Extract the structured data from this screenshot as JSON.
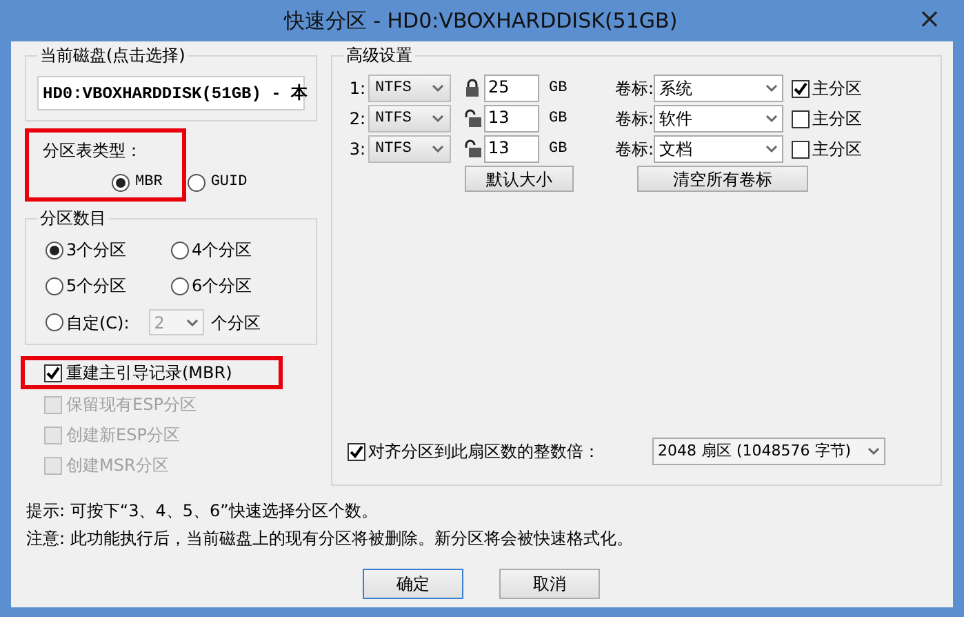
{
  "window": {
    "title": "快速分区 - HD0:VBOXHARDDISK(51GB)",
    "close": "×"
  },
  "current_disk": {
    "legend": "当前磁盘(点击选择)",
    "value": "HD0:VBOXHARDDISK(51GB) - 本"
  },
  "partition_table": {
    "label": "分区表类型：",
    "highlighted": true,
    "options": [
      {
        "label": "MBR",
        "selected": true
      },
      {
        "label": "GUID",
        "selected": false
      }
    ]
  },
  "partition_count": {
    "legend": "分区数目",
    "options": [
      {
        "label": "3个分区",
        "selected": true
      },
      {
        "label": "4个分区",
        "selected": false
      },
      {
        "label": "5个分区",
        "selected": false
      },
      {
        "label": "6个分区",
        "selected": false
      },
      {
        "label": "自定(C):",
        "selected": false
      }
    ],
    "custom_value": "2",
    "custom_suffix": "个分区"
  },
  "options": [
    {
      "label": "重建主引导记录(MBR)",
      "checked": true,
      "disabled": false,
      "highlighted": true
    },
    {
      "label": "保留现有ESP分区",
      "checked": false,
      "disabled": true,
      "highlighted": false
    },
    {
      "label": "创建新ESP分区",
      "checked": false,
      "disabled": true,
      "highlighted": false
    },
    {
      "label": "创建MSR分区",
      "checked": false,
      "disabled": true,
      "highlighted": false
    }
  ],
  "advanced": {
    "legend": "高级设置",
    "rows": [
      {
        "index": "1:",
        "fs": "NTFS",
        "locked": true,
        "size": "25",
        "unit": "GB",
        "volume_label": "卷标:",
        "volume": "系统",
        "primary_label": "主分区",
        "primary": true
      },
      {
        "index": "2:",
        "fs": "NTFS",
        "locked": false,
        "size": "13",
        "unit": "GB",
        "volume_label": "卷标:",
        "volume": "软件",
        "primary_label": "主分区",
        "primary": false
      },
      {
        "index": "3:",
        "fs": "NTFS",
        "locked": false,
        "size": "13",
        "unit": "GB",
        "volume_label": "卷标:",
        "volume": "文档",
        "primary_label": "主分区",
        "primary": false
      }
    ],
    "default_size_button": "默认大小",
    "clear_labels_button": "清空所有卷标",
    "align": {
      "label": "对齐分区到此扇区数的整数倍：",
      "checked": true,
      "value": "2048 扇区 (1048576 字节)"
    }
  },
  "hints": [
    "提示: 可按下“3、4、5、6”快速选择分区个数。",
    "注意: 此功能执行后，当前磁盘上的现有分区将被删除。新分区将会被快速格式化。"
  ],
  "buttons": [
    {
      "label": "确定",
      "default": true
    },
    {
      "label": "取消",
      "default": false
    }
  ]
}
